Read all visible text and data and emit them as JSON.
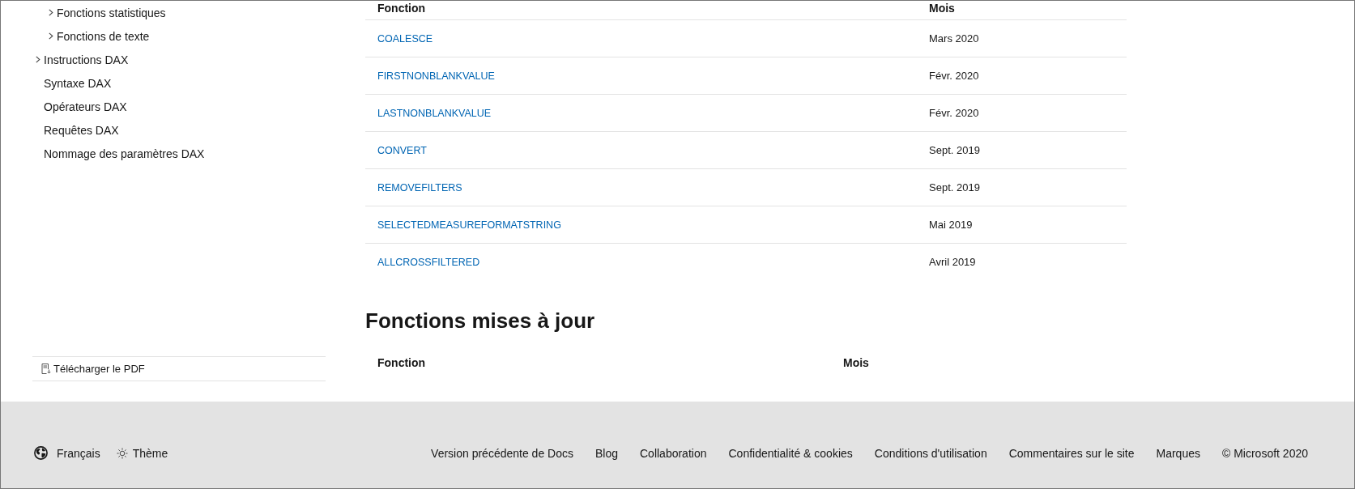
{
  "sidebar": {
    "items": [
      {
        "children": [
          {
            "label": "Fonctions statistiques",
            "kind": "group",
            "expanded": false
          },
          {
            "label": "Fonctions de texte",
            "kind": "group",
            "expanded": false
          }
        ]
      },
      {
        "label": "Instructions DAX",
        "kind": "group",
        "expanded": false
      },
      {
        "label": "Syntaxe DAX",
        "kind": "page"
      },
      {
        "label": "Opérateurs DAX",
        "kind": "page"
      },
      {
        "label": "Requêtes DAX",
        "kind": "page"
      },
      {
        "label": "Nommage des paramètres DAX",
        "kind": "page"
      }
    ],
    "download": {
      "label": "Télécharger le PDF"
    }
  },
  "new_functions": {
    "columns": [
      "Fonction",
      "Mois"
    ],
    "rows": [
      {
        "function": "COALESCE",
        "month": "Mars 2020"
      },
      {
        "function": "FIRSTNONBLANKVALUE",
        "month": "Févr. 2020"
      },
      {
        "function": "LASTNONBLANKVALUE",
        "month": "Févr. 2020"
      },
      {
        "function": "CONVERT",
        "month": "Sept. 2019"
      },
      {
        "function": "REMOVEFILTERS",
        "month": "Sept. 2019"
      },
      {
        "function": "SELECTEDMEASUREFORMATSTRING",
        "month": "Mai 2019"
      },
      {
        "function": "ALLCROSSFILTERED",
        "month": "Avril 2019"
      }
    ]
  },
  "updated_functions": {
    "heading": "Fonctions mises à jour",
    "columns": [
      "Fonction",
      "Mois"
    ]
  },
  "footer": {
    "language": "Français",
    "theme": "Thème",
    "links": [
      "Version précédente de Docs",
      "Blog",
      "Collaboration",
      "Confidentialité & cookies",
      "Conditions d'utilisation",
      "Commentaires sur le site",
      "Marques"
    ],
    "copyright": "© Microsoft 2020"
  }
}
